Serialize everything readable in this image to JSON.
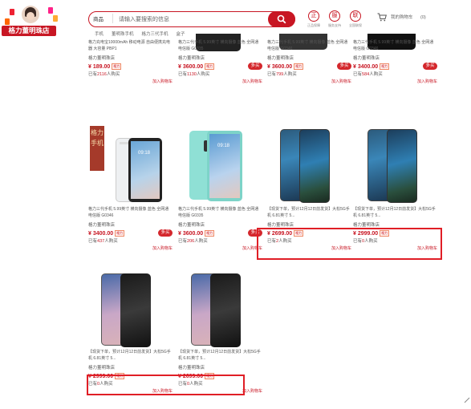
{
  "logo": {
    "badge": "格力董明珠店"
  },
  "search": {
    "category": "商品",
    "placeholder": "请输入要搜索的信息"
  },
  "hot_words": [
    "手机",
    "董明珠手机",
    "格力三代手机",
    "盒子"
  ],
  "quick_links": [
    {
      "label": "正品保障",
      "icon": "正"
    },
    {
      "label": "服务支持",
      "icon": "服"
    },
    {
      "label": "全国联保",
      "icon": "联"
    }
  ],
  "cart": {
    "label": "我的购物车",
    "count": "(0)"
  },
  "products_row1": [
    {
      "desc": "格力充电宝10000mAh 移动电源 自由便携充电器 大容量 PBP1",
      "store": "格力董明珠店",
      "price": "¥ 189.00",
      "tag": "格力",
      "sold_prefix": "已有",
      "sold_count": "2116",
      "sold_suffix": "人购买",
      "add": "加入购物车",
      "pill": ""
    },
    {
      "desc": "格力三代手机 5.99英寸 横向摄像 蓝色 全网通 电信版 G0335",
      "store": "格力董明珠店",
      "price": "¥ 3600.00",
      "tag": "格力",
      "sold_prefix": "已有",
      "sold_count": "1130",
      "sold_suffix": "人购买",
      "add": "加入购物车",
      "pill": "多买"
    },
    {
      "desc": "格力三代手机 5.99英寸 横向摄像 蓝色 全网通 电信版 G0346",
      "store": "格力董明珠店",
      "price": "¥ 3600.00",
      "tag": "格力",
      "sold_prefix": "已有",
      "sold_count": "799",
      "sold_suffix": "人购买",
      "add": "加入购物车",
      "pill": "多买"
    },
    {
      "desc": "格力三代手机 5.99英寸 横向摄像 蓝色 全网通 电信版 G0346",
      "store": "格力董明珠店",
      "price": "¥ 3400.00",
      "tag": "格力",
      "sold_prefix": "已有",
      "sold_count": "584",
      "sold_suffix": "人购买",
      "add": "加入购物车",
      "pill": "多买"
    }
  ],
  "products_row2": [
    {
      "desc": "格力三代手机 5.99英寸 横向摄像 蓝色 全网通 电信版 G0346",
      "store": "格力董明珠店",
      "price": "¥ 3400.00",
      "tag": "格力",
      "sold_prefix": "已有",
      "sold_count": "437",
      "sold_suffix": "人购买",
      "add": "加入购物车",
      "pill": "多买",
      "promo": "格力手机"
    },
    {
      "desc": "格力三代手机 5.99英寸 横向摄像 蓝色 全网通 电信版 G0335",
      "store": "格力董明珠店",
      "price": "¥ 3600.00",
      "tag": "格力",
      "sold_prefix": "已有",
      "sold_count": "206",
      "sold_suffix": "人购买",
      "add": "加入购物车",
      "pill": "多买"
    },
    {
      "desc": "【现货下单，预计12月12日前发货】大松5G手机 6.81英寸 5...",
      "store": "格力董明珠店",
      "price": "¥ 2699.00",
      "tag": "格力",
      "sold_prefix": "已有",
      "sold_count": "2",
      "sold_suffix": "人购买",
      "add": "加入购物车",
      "pill": ""
    },
    {
      "desc": "【现货下单，预计12月12日前发货】大松5G手机 6.81英寸 5...",
      "store": "格力董明珠店",
      "price": "¥ 2999.00",
      "tag": "格力",
      "sold_prefix": "已有",
      "sold_count": "0",
      "sold_suffix": "人购买",
      "add": "加入购物车",
      "pill": ""
    }
  ],
  "products_row3": [
    {
      "desc": "【现货下单，预计12月12日前发货】大松5G手机 6.81英寸 5...",
      "store": "格力董明珠店",
      "price": "¥ 2999.00",
      "tag": "格力",
      "sold_prefix": "已有",
      "sold_count": "0",
      "sold_suffix": "人购买",
      "add": "加入购物车",
      "pill": ""
    },
    {
      "desc": "【现货下单，预计12月12日前发货】大松5G手机 6.81英寸 5...",
      "store": "格力董明珠店",
      "price": "¥ 2699.00",
      "tag": "格力",
      "sold_prefix": "已有",
      "sold_count": "0",
      "sold_suffix": "人购买",
      "add": "加入购物车",
      "pill": ""
    }
  ],
  "colors": {
    "accent": "#c81623",
    "highlight": "#e01e26"
  },
  "phone_screens": {
    "time1": "09:18",
    "time2": "09:18"
  }
}
